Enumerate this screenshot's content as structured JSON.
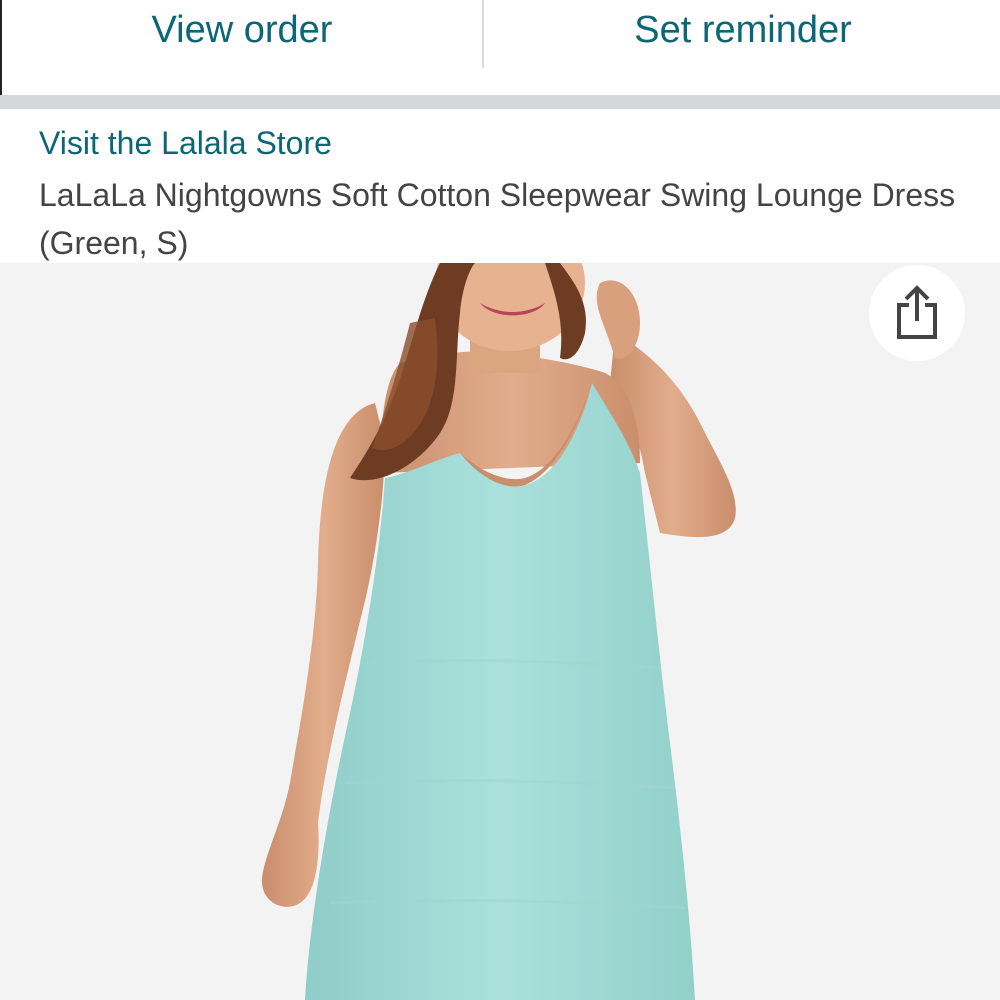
{
  "actions": {
    "view_order": "View order",
    "set_reminder": "Set reminder"
  },
  "product": {
    "store_link": "Visit the Lalala Store",
    "title": "LaLaLa Nightgowns Soft Cotton Sleepwear Swing Lounge Dress (Green, S)"
  },
  "image": {
    "subject": "woman wearing mint green sleeveless nightgown",
    "dress_color": "#a6dad6"
  },
  "icons": {
    "share": "share-icon"
  },
  "colors": {
    "link": "#0b6675",
    "text": "#444444",
    "separator": "#d5d8db",
    "image_bg": "#f2f2f2"
  }
}
